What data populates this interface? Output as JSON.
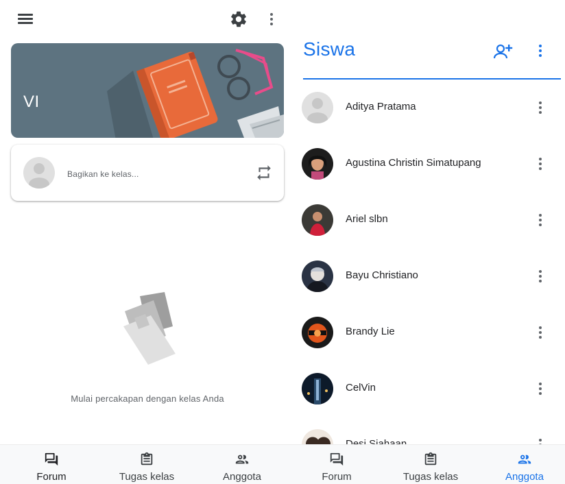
{
  "left_screen": {
    "class_name": "VI",
    "share_placeholder": "Bagikan ke kelas...",
    "empty_state_text": "Mulai percakapan dengan kelas Anda",
    "bottom_nav": [
      {
        "label": "Forum",
        "icon": "forum-icon",
        "active": true
      },
      {
        "label": "Tugas kelas",
        "icon": "classwork-icon",
        "active": false
      },
      {
        "label": "Anggota",
        "icon": "people-icon",
        "active": false
      }
    ]
  },
  "right_screen": {
    "title": "Siswa",
    "students": [
      {
        "name": "Aditya Pratama",
        "avatar": "default-avatar"
      },
      {
        "name": "Agustina Christin Simatupang",
        "avatar": "photo-avatar"
      },
      {
        "name": "Ariel slbn",
        "avatar": "photo-avatar"
      },
      {
        "name": "Bayu Christiano",
        "avatar": "photo-avatar"
      },
      {
        "name": "Brandy Lie",
        "avatar": "photo-avatar"
      },
      {
        "name": "CelVin",
        "avatar": "photo-avatar"
      },
      {
        "name": "Desi Siahaan",
        "avatar": "photo-avatar"
      }
    ],
    "bottom_nav": [
      {
        "label": "Forum",
        "icon": "forum-icon",
        "active": false
      },
      {
        "label": "Tugas kelas",
        "icon": "classwork-icon",
        "active": false
      },
      {
        "label": "Anggota",
        "icon": "people-icon",
        "active": true
      }
    ]
  },
  "colors": {
    "accent": "#1a73e8",
    "banner": "#5d7380",
    "text_primary": "#202124",
    "text_secondary": "#5f6368"
  }
}
